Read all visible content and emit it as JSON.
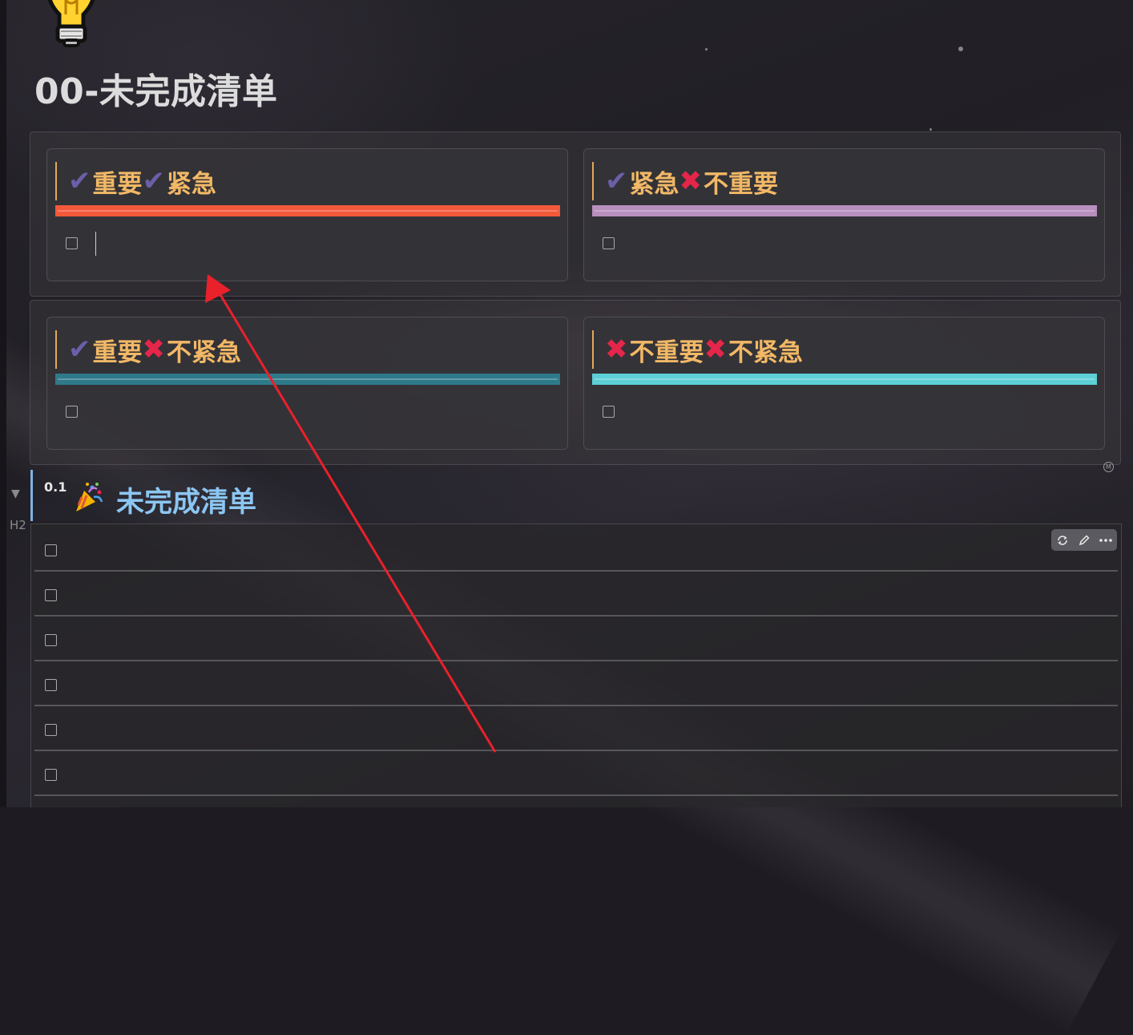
{
  "page": {
    "title": "00-未完成清单"
  },
  "icons": {
    "page_icon": "light-bulb-icon",
    "heading_icon": "party-popper-icon"
  },
  "quadrants": [
    {
      "marker1": "✔",
      "part1": "重要",
      "marker2": "✔",
      "part2": "紧急",
      "divider_color": "#f2593a"
    },
    {
      "marker1": "✔",
      "part1": "紧急",
      "marker2": "✖",
      "part2": "不重要",
      "divider_color": "#b98fbe"
    },
    {
      "marker1": "✔",
      "part1": "重要",
      "marker2": "✖",
      "part2": "不紧急",
      "divider_color": "#2e7a8a"
    },
    {
      "marker1": "✖",
      "part1": "不重要",
      "marker2": "✖",
      "part2": "不紧急",
      "divider_color": "#5cd0d6"
    }
  ],
  "heading": {
    "number": "0.1",
    "text": "未完成清单",
    "level_tag": "H2",
    "accent": "#7fb3e6"
  },
  "badge": {
    "text": "M"
  },
  "colors": {
    "title_accent": "#f2b866",
    "check": "#6b5fa8",
    "cross": "#e5264a",
    "annotation_arrow": "#e8212b"
  }
}
